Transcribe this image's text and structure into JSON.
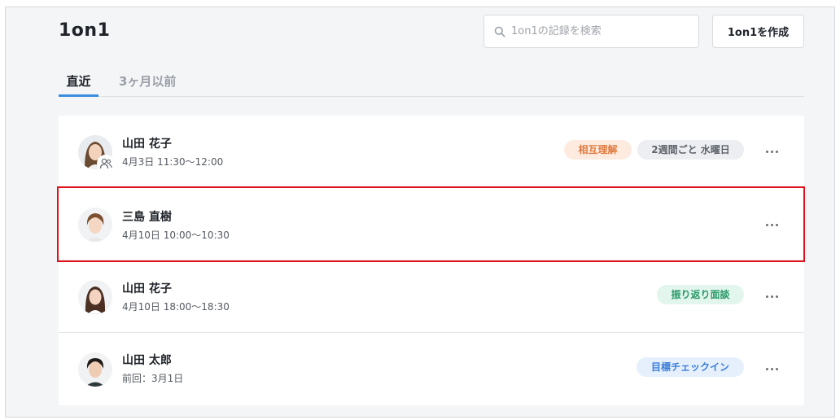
{
  "header": {
    "title": "1on1"
  },
  "search": {
    "placeholder": "1on1の記録を検索",
    "icon": "search-icon"
  },
  "toolbar": {
    "create_label": "1on1を作成"
  },
  "tabs": [
    {
      "label": "直近",
      "active": true
    },
    {
      "label": "3ヶ月以前",
      "active": false
    }
  ],
  "meetings": [
    {
      "name": "山田 花子",
      "time": "4月3日 11:30〜12:00",
      "group": true,
      "tags": [
        {
          "label": "相互理解",
          "bg": "#fdebe0",
          "color": "#e07b3f"
        },
        {
          "label": "2週間ごと 水曜日",
          "bg": "#eceef1",
          "color": "#5f646c"
        }
      ]
    },
    {
      "name": "三島 直樹",
      "time": "4月10日 10:00〜10:30",
      "group": false,
      "tags": []
    },
    {
      "name": "山田 花子",
      "time": "4月10日 18:00〜18:30",
      "group": false,
      "tags": [
        {
          "label": "振り返り面談",
          "bg": "#e3f6ee",
          "color": "#2e9a6a"
        }
      ]
    },
    {
      "name": "山田 太郎",
      "time": "前回：3月1日",
      "group": false,
      "tags": [
        {
          "label": "目標チェックイン",
          "bg": "#e6f0fc",
          "color": "#3b7ed8"
        }
      ]
    }
  ]
}
